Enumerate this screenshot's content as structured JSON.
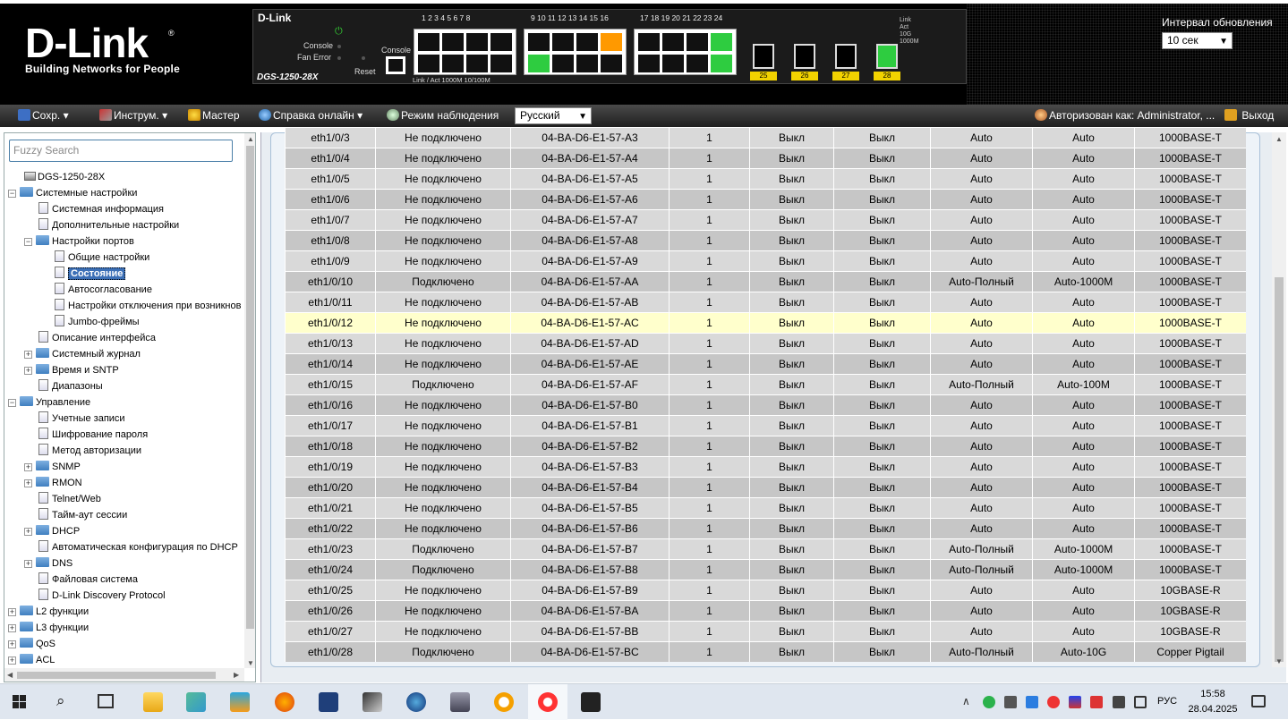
{
  "header": {
    "logo_text": "D-Link",
    "logo_reg": "®",
    "logo_tagline": "Building Networks for People",
    "device_brand": "D-Link",
    "device_model": "DGS-1250-28X",
    "console_label": "Console",
    "fan_error_label": "Fan Error",
    "reset_label": "Reset",
    "console_port_label": "Console",
    "port_numbers_group1": "1 2 3 4 5 6 7 8",
    "port_numbers_group2": "9 10 11 12 13 14 15 16",
    "port_numbers_group3": "17 18 19 20 21 22 23 24",
    "link_act_legend": "Link / Act   1000M  10/100M",
    "sfp_ports": [
      "25",
      "26",
      "27",
      "28"
    ],
    "legend": [
      "Link",
      "Act",
      "10G",
      "1000M"
    ],
    "refresh_label": "Интервал обновления",
    "refresh_value": "10 сек"
  },
  "menubar": {
    "save": "Сохр.",
    "tools": "Инструм.",
    "wizard": "Мастер",
    "help": "Справка онлайн",
    "monitor": "Режим наблюдения",
    "language": "Русский",
    "logged_in": "Авторизован как: Administrator, ...",
    "logout": "Выход"
  },
  "sidebar": {
    "search_placeholder": "Fuzzy Search",
    "tree": [
      {
        "label": "DGS-1250-28X"
      },
      {
        "label": "Системные настройки"
      },
      {
        "label": "Системная информация"
      },
      {
        "label": "Дополнительные настройки"
      },
      {
        "label": "Настройки портов"
      },
      {
        "label": "Общие настройки"
      },
      {
        "label": "Состояние"
      },
      {
        "label": "Автосогласование"
      },
      {
        "label": "Настройки отключения при возникнов"
      },
      {
        "label": "Jumbo-фреймы"
      },
      {
        "label": "Описание интерфейса"
      },
      {
        "label": "Системный журнал"
      },
      {
        "label": "Время и SNTP"
      },
      {
        "label": "Диапазоны"
      },
      {
        "label": "Управление"
      },
      {
        "label": "Учетные записи"
      },
      {
        "label": "Шифрование пароля"
      },
      {
        "label": "Метод авторизации"
      },
      {
        "label": "SNMP"
      },
      {
        "label": "RMON"
      },
      {
        "label": "Telnet/Web"
      },
      {
        "label": "Тайм-аут сессии"
      },
      {
        "label": "DHCP"
      },
      {
        "label": "Автоматическая конфигурация по DHCP"
      },
      {
        "label": "DNS"
      },
      {
        "label": "Файловая система"
      },
      {
        "label": "D-Link Discovery Protocol"
      },
      {
        "label": "L2 функции"
      },
      {
        "label": "L3 функции"
      },
      {
        "label": "QoS"
      },
      {
        "label": "ACL"
      }
    ]
  },
  "table": {
    "rows": [
      [
        "eth1/0/3",
        "Не подключено",
        "04-BA-D6-E1-57-A3",
        "1",
        "Выкл",
        "Выкл",
        "Auto",
        "Auto",
        "1000BASE-T"
      ],
      [
        "eth1/0/4",
        "Не подключено",
        "04-BA-D6-E1-57-A4",
        "1",
        "Выкл",
        "Выкл",
        "Auto",
        "Auto",
        "1000BASE-T"
      ],
      [
        "eth1/0/5",
        "Не подключено",
        "04-BA-D6-E1-57-A5",
        "1",
        "Выкл",
        "Выкл",
        "Auto",
        "Auto",
        "1000BASE-T"
      ],
      [
        "eth1/0/6",
        "Не подключено",
        "04-BA-D6-E1-57-A6",
        "1",
        "Выкл",
        "Выкл",
        "Auto",
        "Auto",
        "1000BASE-T"
      ],
      [
        "eth1/0/7",
        "Не подключено",
        "04-BA-D6-E1-57-A7",
        "1",
        "Выкл",
        "Выкл",
        "Auto",
        "Auto",
        "1000BASE-T"
      ],
      [
        "eth1/0/8",
        "Не подключено",
        "04-BA-D6-E1-57-A8",
        "1",
        "Выкл",
        "Выкл",
        "Auto",
        "Auto",
        "1000BASE-T"
      ],
      [
        "eth1/0/9",
        "Не подключено",
        "04-BA-D6-E1-57-A9",
        "1",
        "Выкл",
        "Выкл",
        "Auto",
        "Auto",
        "1000BASE-T"
      ],
      [
        "eth1/0/10",
        "Подключено",
        "04-BA-D6-E1-57-AA",
        "1",
        "Выкл",
        "Выкл",
        "Auto-Полный",
        "Auto-1000M",
        "1000BASE-T"
      ],
      [
        "eth1/0/11",
        "Не подключено",
        "04-BA-D6-E1-57-AB",
        "1",
        "Выкл",
        "Выкл",
        "Auto",
        "Auto",
        "1000BASE-T"
      ],
      [
        "eth1/0/12",
        "Не подключено",
        "04-BA-D6-E1-57-AC",
        "1",
        "Выкл",
        "Выкл",
        "Auto",
        "Auto",
        "1000BASE-T"
      ],
      [
        "eth1/0/13",
        "Не подключено",
        "04-BA-D6-E1-57-AD",
        "1",
        "Выкл",
        "Выкл",
        "Auto",
        "Auto",
        "1000BASE-T"
      ],
      [
        "eth1/0/14",
        "Не подключено",
        "04-BA-D6-E1-57-AE",
        "1",
        "Выкл",
        "Выкл",
        "Auto",
        "Auto",
        "1000BASE-T"
      ],
      [
        "eth1/0/15",
        "Подключено",
        "04-BA-D6-E1-57-AF",
        "1",
        "Выкл",
        "Выкл",
        "Auto-Полный",
        "Auto-100M",
        "1000BASE-T"
      ],
      [
        "eth1/0/16",
        "Не подключено",
        "04-BA-D6-E1-57-B0",
        "1",
        "Выкл",
        "Выкл",
        "Auto",
        "Auto",
        "1000BASE-T"
      ],
      [
        "eth1/0/17",
        "Не подключено",
        "04-BA-D6-E1-57-B1",
        "1",
        "Выкл",
        "Выкл",
        "Auto",
        "Auto",
        "1000BASE-T"
      ],
      [
        "eth1/0/18",
        "Не подключено",
        "04-BA-D6-E1-57-B2",
        "1",
        "Выкл",
        "Выкл",
        "Auto",
        "Auto",
        "1000BASE-T"
      ],
      [
        "eth1/0/19",
        "Не подключено",
        "04-BA-D6-E1-57-B3",
        "1",
        "Выкл",
        "Выкл",
        "Auto",
        "Auto",
        "1000BASE-T"
      ],
      [
        "eth1/0/20",
        "Не подключено",
        "04-BA-D6-E1-57-B4",
        "1",
        "Выкл",
        "Выкл",
        "Auto",
        "Auto",
        "1000BASE-T"
      ],
      [
        "eth1/0/21",
        "Не подключено",
        "04-BA-D6-E1-57-B5",
        "1",
        "Выкл",
        "Выкл",
        "Auto",
        "Auto",
        "1000BASE-T"
      ],
      [
        "eth1/0/22",
        "Не подключено",
        "04-BA-D6-E1-57-B6",
        "1",
        "Выкл",
        "Выкл",
        "Auto",
        "Auto",
        "1000BASE-T"
      ],
      [
        "eth1/0/23",
        "Подключено",
        "04-BA-D6-E1-57-B7",
        "1",
        "Выкл",
        "Выкл",
        "Auto-Полный",
        "Auto-1000M",
        "1000BASE-T"
      ],
      [
        "eth1/0/24",
        "Подключено",
        "04-BA-D6-E1-57-B8",
        "1",
        "Выкл",
        "Выкл",
        "Auto-Полный",
        "Auto-1000M",
        "1000BASE-T"
      ],
      [
        "eth1/0/25",
        "Не подключено",
        "04-BA-D6-E1-57-B9",
        "1",
        "Выкл",
        "Выкл",
        "Auto",
        "Auto",
        "10GBASE-R"
      ],
      [
        "eth1/0/26",
        "Не подключено",
        "04-BA-D6-E1-57-BA",
        "1",
        "Выкл",
        "Выкл",
        "Auto",
        "Auto",
        "10GBASE-R"
      ],
      [
        "eth1/0/27",
        "Не подключено",
        "04-BA-D6-E1-57-BB",
        "1",
        "Выкл",
        "Выкл",
        "Auto",
        "Auto",
        "10GBASE-R"
      ],
      [
        "eth1/0/28",
        "Подключено",
        "04-BA-D6-E1-57-BC",
        "1",
        "Выкл",
        "Выкл",
        "Auto-Полный",
        "Auto-10G",
        "Copper Pigtail"
      ]
    ]
  },
  "taskbar": {
    "lang": "РУС",
    "time": "15:58",
    "date": "28.04.2025"
  },
  "colors": {
    "row_odd": "#d9d9d9",
    "row_even": "#c6c6c6",
    "row_highlight": "#ffffcc",
    "selected_tree": "#3b6fb6",
    "port_green": "#2ecc40",
    "port_amber": "#ff9900"
  }
}
